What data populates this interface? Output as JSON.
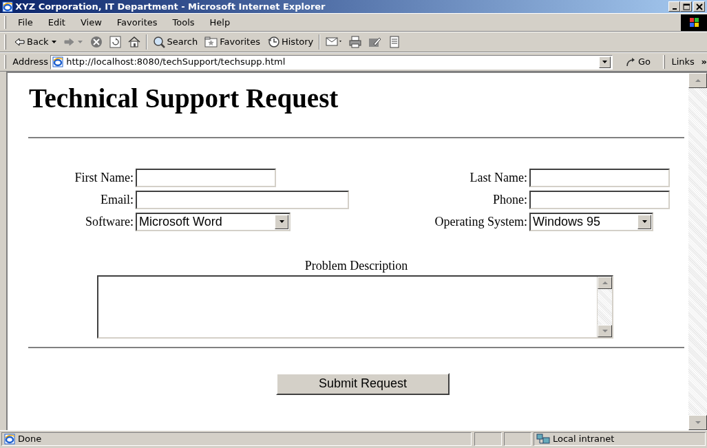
{
  "window": {
    "title": "XYZ Corporation, IT Department - Microsoft Internet Explorer"
  },
  "menu": [
    "File",
    "Edit",
    "View",
    "Favorites",
    "Tools",
    "Help"
  ],
  "toolbar": [
    {
      "kind": "back",
      "label": "Back"
    },
    {
      "kind": "forward"
    },
    {
      "kind": "stop"
    },
    {
      "kind": "refresh"
    },
    {
      "kind": "home"
    },
    {
      "kind": "search",
      "label": "Search"
    },
    {
      "kind": "favorites",
      "label": "Favorites"
    },
    {
      "kind": "history",
      "label": "History"
    },
    {
      "kind": "mail"
    },
    {
      "kind": "print"
    },
    {
      "kind": "edit"
    },
    {
      "kind": "discuss"
    }
  ],
  "address_bar": {
    "label": "Address",
    "url": "http://localhost:8080/techSupport/techsupp.html",
    "go": "Go",
    "links": "Links",
    "more": "»"
  },
  "page": {
    "heading": "Technical Support Request",
    "fields": [
      {
        "kind": "text",
        "label": "First Name:"
      },
      {
        "kind": "text",
        "label": "Last Name:"
      },
      {
        "kind": "text",
        "label": "Email:"
      },
      {
        "kind": "text",
        "label": "Phone:"
      },
      {
        "kind": "select",
        "label": "Software:",
        "value": "Microsoft Word"
      },
      {
        "kind": "select",
        "label": "Operating System:",
        "value": "Windows 95"
      }
    ],
    "description_label": "Problem Description",
    "submit": "Submit Request"
  },
  "status_bar": {
    "text": "Done",
    "zone": "Local intranet"
  }
}
